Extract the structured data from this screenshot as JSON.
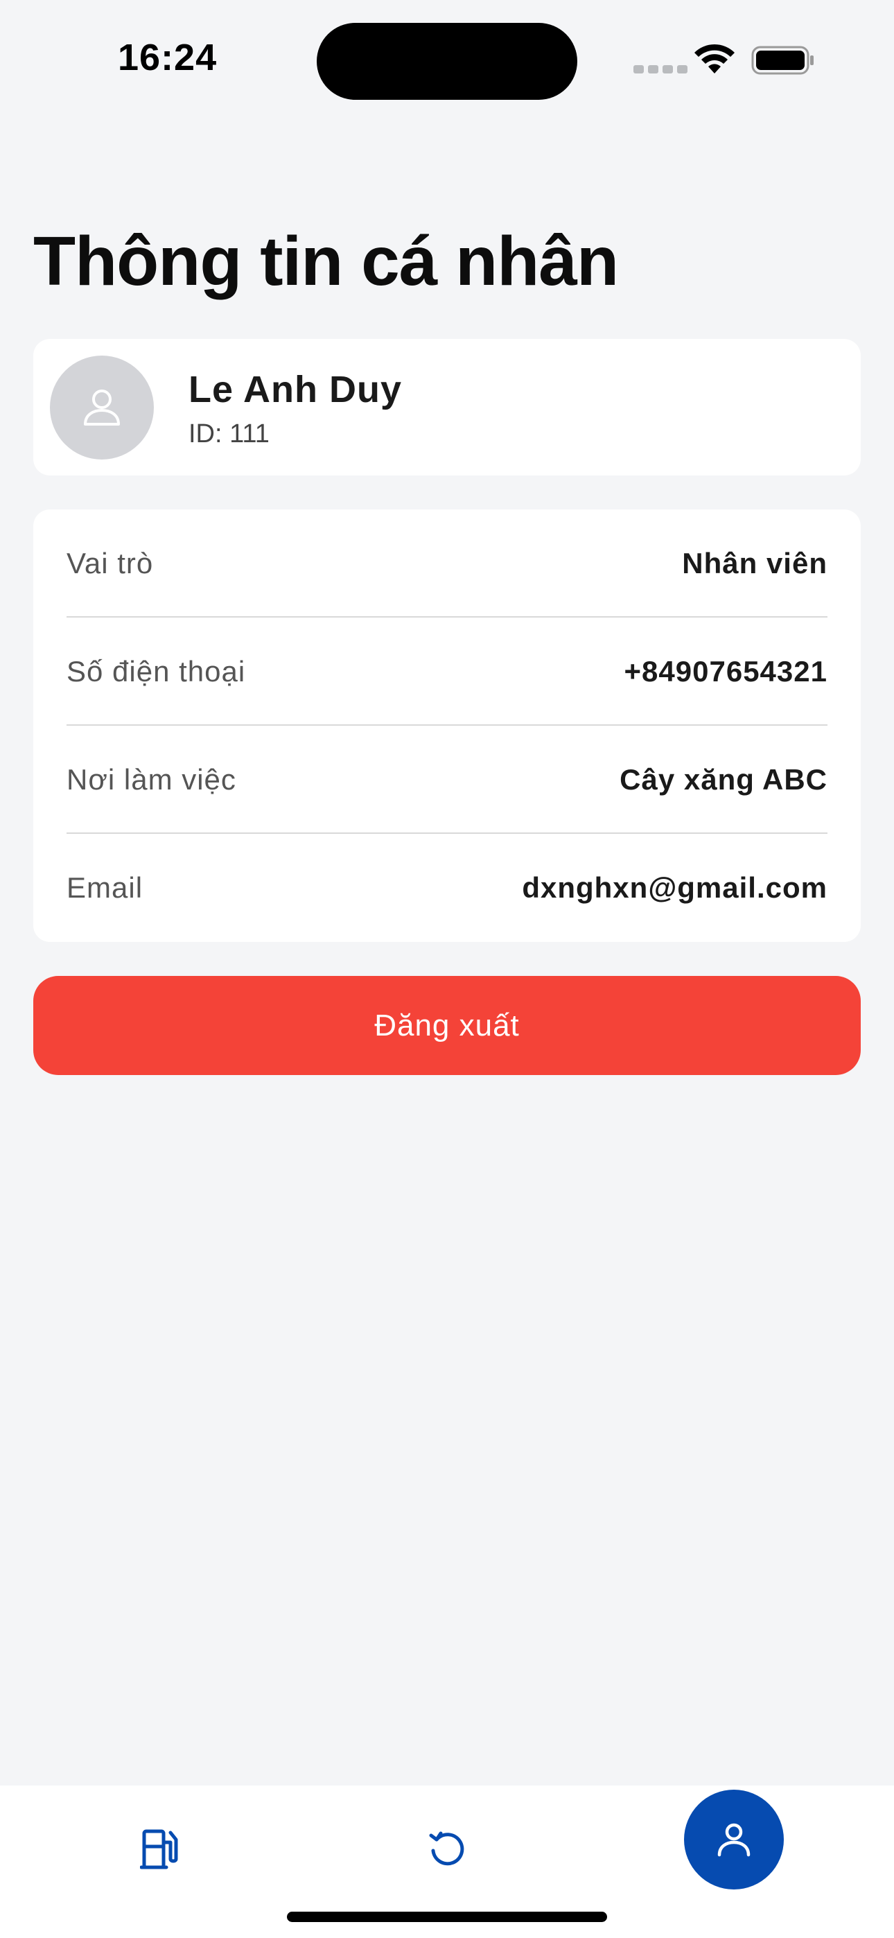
{
  "status_bar": {
    "time": "16:24"
  },
  "page": {
    "title": "Thông tin cá nhân"
  },
  "profile": {
    "name": "Le Anh Duy",
    "id_text": "ID: 111",
    "avatar_icon": "person-icon"
  },
  "info": {
    "rows": [
      {
        "label": "Vai trò",
        "value": "Nhân viên"
      },
      {
        "label": "Số điện thoại",
        "value": "+84907654321"
      },
      {
        "label": "Nơi làm việc",
        "value": "Cây xăng ABC"
      },
      {
        "label": "Email",
        "value": "dxnghxn@gmail.com"
      }
    ]
  },
  "actions": {
    "logout_label": "Đăng xuất"
  },
  "nav": {
    "items": [
      {
        "icon": "fuel-pump-icon",
        "active": false
      },
      {
        "icon": "history-icon",
        "active": false
      },
      {
        "icon": "person-icon",
        "active": true
      }
    ]
  },
  "colors": {
    "background": "#f4f5f7",
    "card": "#ffffff",
    "logout": "#f44338",
    "accent": "#064bb0",
    "avatar_bg": "#d3d4d8"
  }
}
